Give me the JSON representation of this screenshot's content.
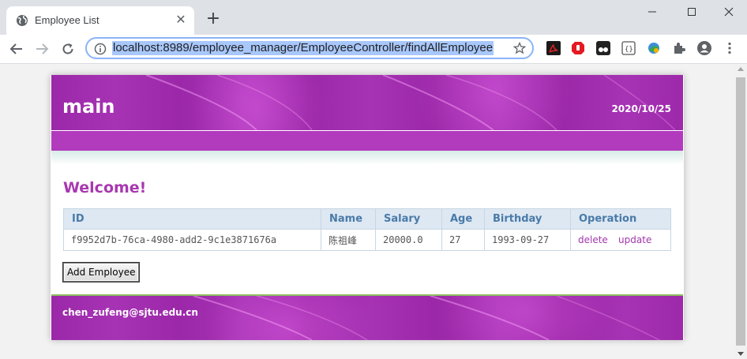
{
  "browser": {
    "tab_title": "Employee List",
    "new_tab": "+",
    "url": "localhost:8989/employee_manager/EmployeeController/findAllEmployee"
  },
  "page": {
    "site_title": "main",
    "date": "2020/10/25",
    "welcome": "Welcome!",
    "table": {
      "headers": [
        "ID",
        "Name",
        "Salary",
        "Age",
        "Birthday",
        "Operation"
      ],
      "rows": [
        {
          "id": "f9952d7b-76ca-4980-add2-9c1e3871676a",
          "name": "陈祖峰",
          "salary": "20000.0",
          "age": "27",
          "birthday": "1993-09-27",
          "delete": "delete",
          "update": "update"
        }
      ]
    },
    "add_button": "Add Employee",
    "footer_email": "chen_zufeng@sjtu.edu.cn"
  },
  "colors": {
    "banner_purple": "#a030b0",
    "menubar_purple": "#b23bbd",
    "welcome_text": "#a838b0",
    "table_header_bg": "#dde8f3",
    "table_header_text": "#4a7aa8",
    "link": "#a336ad",
    "omnibox_focus": "#8ab4f8"
  },
  "icons": {
    "favicon": "globe-icon",
    "info": "info-icon",
    "bookmark": "star-icon",
    "extensions": [
      "pdf-extension-icon",
      "adblock-extension-icon",
      "tampermonkey-extension-icon",
      "json-extension-icon",
      "vpn-extension-icon",
      "puzzle-icon",
      "profile-icon",
      "kebab-menu-icon"
    ]
  }
}
